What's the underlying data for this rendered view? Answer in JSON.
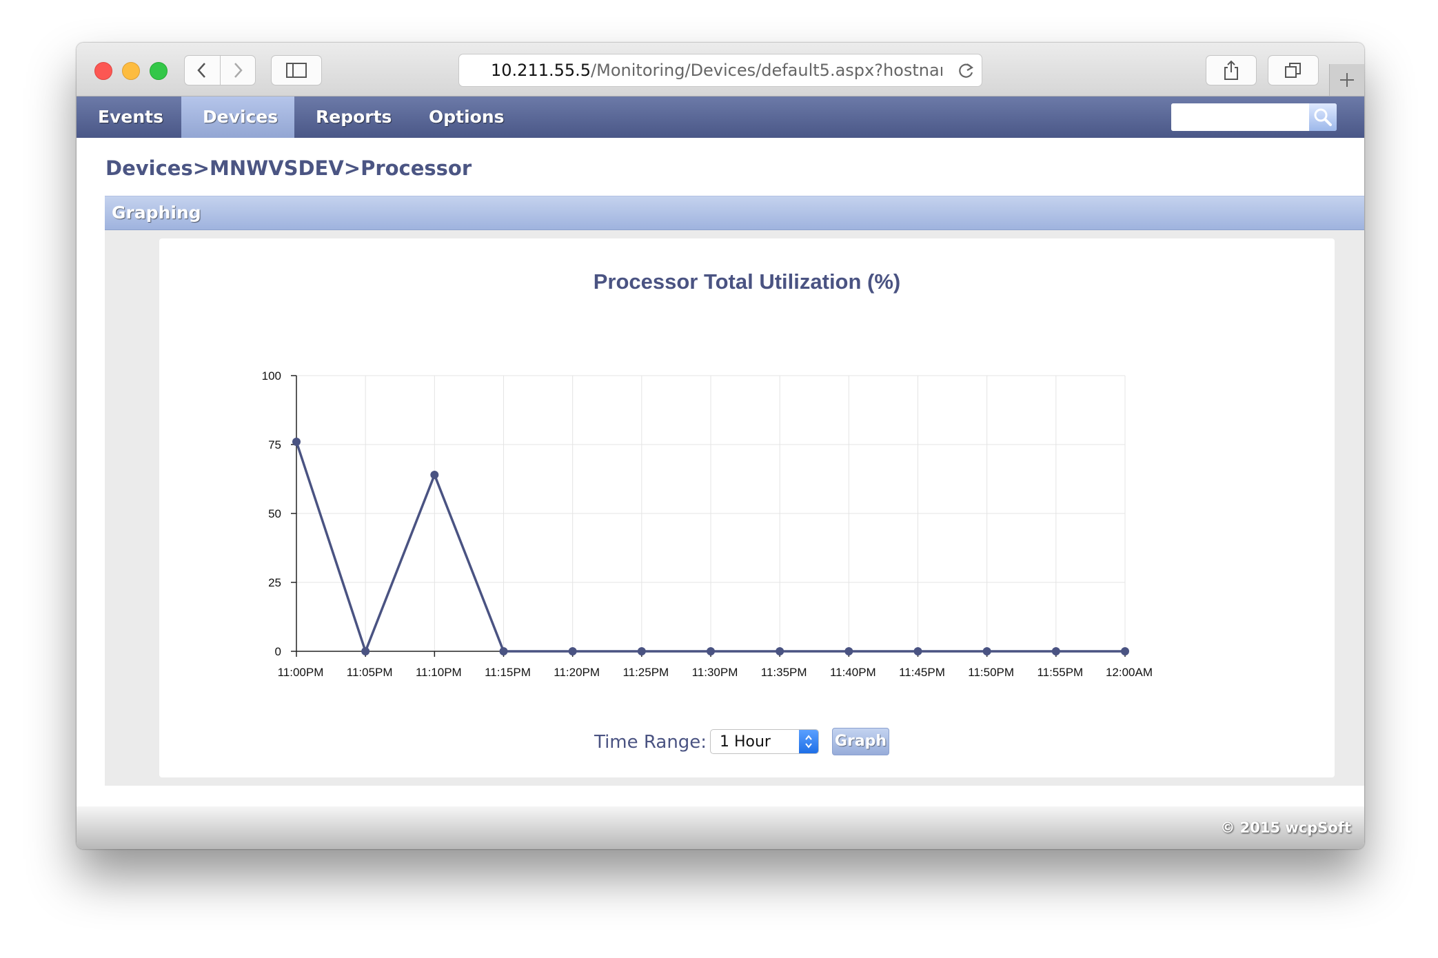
{
  "browser": {
    "address_host": "10.211.55.5",
    "address_path": "/Monitoring/Devices/default5.aspx?hostname=MNWVSDEV",
    "icons": [
      "back-icon",
      "forward-icon",
      "sidebar-icon",
      "reload-icon",
      "share-icon",
      "tabs-icon",
      "plus-icon"
    ]
  },
  "nav": {
    "items": [
      {
        "label": "Events",
        "active": false
      },
      {
        "label": "Devices",
        "active": true
      },
      {
        "label": "Reports",
        "active": false
      },
      {
        "label": "Options",
        "active": false
      }
    ],
    "search_placeholder": ""
  },
  "breadcrumb": "Devices>MNWVSDEV>Processor",
  "panel": {
    "title": "Graphing"
  },
  "chart_data": {
    "type": "line",
    "title": "Processor Total Utilization (%)",
    "xlabel": "",
    "ylabel": "",
    "x": [
      "11:00PM",
      "11:05PM",
      "11:10PM",
      "11:15PM",
      "11:20PM",
      "11:25PM",
      "11:30PM",
      "11:35PM",
      "11:40PM",
      "11:45PM",
      "11:50PM",
      "11:55PM",
      "12:00AM"
    ],
    "y_ticks": [
      0,
      25,
      50,
      75,
      100
    ],
    "ylim": [
      0,
      100
    ],
    "grid": true,
    "series": [
      {
        "values": [
          76,
          0,
          64,
          0,
          0,
          0,
          0,
          0,
          0,
          0,
          0,
          0,
          0
        ],
        "color": "#4a5382"
      }
    ]
  },
  "controls": {
    "time_range_label": "Time Range:",
    "time_range_value": "1 Hour",
    "graph_button": "Graph"
  },
  "footer": {
    "copyright": "© 2015 wcpSoft"
  },
  "colors": {
    "nav_bg": "#56639a",
    "active_tab": "#a6b8e0",
    "title_text": "#4a5382",
    "header_bar": "#aebfe5"
  }
}
